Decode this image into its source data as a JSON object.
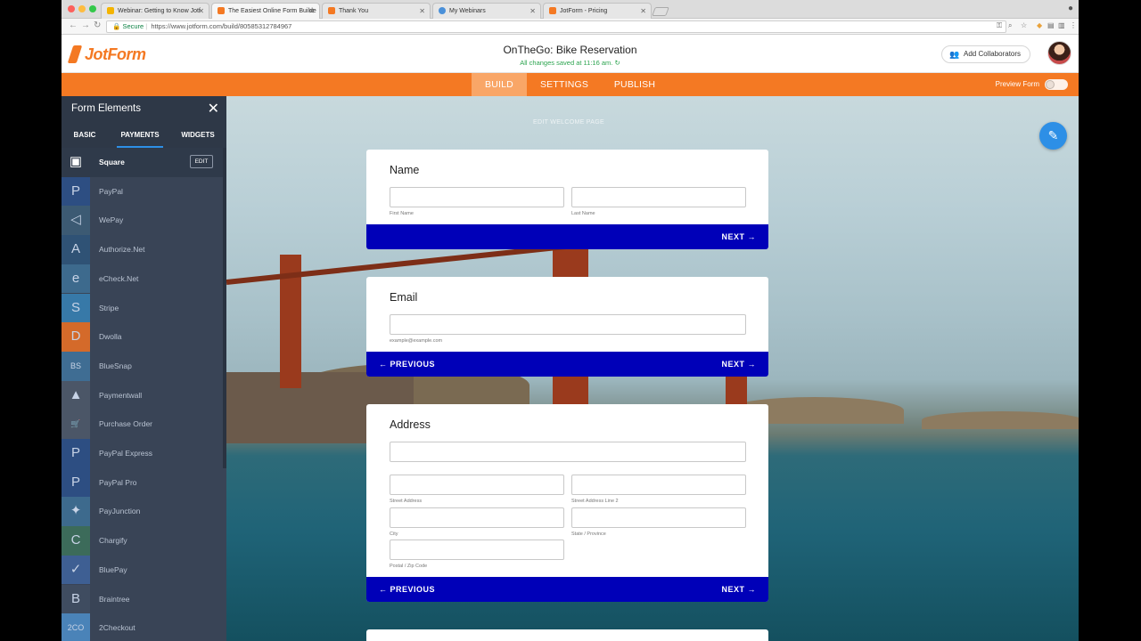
{
  "browser": {
    "tabs": [
      {
        "title": "Webinar: Getting to Know Jotf",
        "active": false
      },
      {
        "title": "The Easiest Online Form Builde",
        "active": true
      },
      {
        "title": "Thank You",
        "active": false
      },
      {
        "title": "My Webinars",
        "active": false
      },
      {
        "title": "JotForm - Pricing",
        "active": false
      }
    ],
    "secure_label": "Secure",
    "url": "https://www.jotform.com/build/80585312784967"
  },
  "header": {
    "logo_text": "JotForm",
    "form_title": "OnTheGo: Bike Reservation",
    "saved_status": "All changes saved at 11:16 am.",
    "collab_label": "Add Collaborators"
  },
  "topnav": {
    "tabs": [
      "BUILD",
      "SETTINGS",
      "PUBLISH"
    ],
    "preview_label": "Preview Form"
  },
  "panel": {
    "title": "Form Elements",
    "tabs": [
      "BASIC",
      "PAYMENTS",
      "WIDGETS"
    ],
    "edit_label": "EDIT",
    "items": [
      {
        "label": "Square",
        "icon": "square-icon",
        "glyph": "▣"
      },
      {
        "label": "PayPal",
        "icon": "paypal-icon",
        "glyph": "P"
      },
      {
        "label": "WePay",
        "icon": "wepay-icon",
        "glyph": "◁"
      },
      {
        "label": "Authorize.Net",
        "icon": "authorize-net-icon",
        "glyph": "A"
      },
      {
        "label": "eCheck.Net",
        "icon": "echeck-icon",
        "glyph": "e"
      },
      {
        "label": "Stripe",
        "icon": "stripe-icon",
        "glyph": "S"
      },
      {
        "label": "Dwolla",
        "icon": "dwolla-icon",
        "glyph": "D"
      },
      {
        "label": "BlueSnap",
        "icon": "bluesnap-icon",
        "glyph": "BS"
      },
      {
        "label": "Paymentwall",
        "icon": "paymentwall-icon",
        "glyph": "▲"
      },
      {
        "label": "Purchase Order",
        "icon": "cart-icon",
        "glyph": "🛒"
      },
      {
        "label": "PayPal Express",
        "icon": "paypal-express-icon",
        "glyph": "P"
      },
      {
        "label": "PayPal Pro",
        "icon": "paypal-pro-icon",
        "glyph": "P"
      },
      {
        "label": "PayJunction",
        "icon": "payjunction-icon",
        "glyph": "✦"
      },
      {
        "label": "Chargify",
        "icon": "chargify-icon",
        "glyph": "C"
      },
      {
        "label": "BluePay",
        "icon": "bluepay-icon",
        "glyph": "✓"
      },
      {
        "label": "Braintree",
        "icon": "braintree-icon",
        "glyph": "B"
      },
      {
        "label": "2Checkout",
        "icon": "2checkout-icon",
        "glyph": "2CO"
      }
    ]
  },
  "canvas": {
    "edit_welcome": "EDIT WELCOME PAGE",
    "cards": [
      {
        "title": "Name",
        "sublabels": [
          "First Name",
          "Last Name"
        ],
        "prev": "",
        "next": "NEXT"
      },
      {
        "title": "Email",
        "sublabels": [
          "example@example.com"
        ],
        "prev": "PREVIOUS",
        "next": "NEXT"
      },
      {
        "title": "Address",
        "sublabels": [
          "Street Address",
          "Street Address Line 2",
          "City",
          "State / Province",
          "Postal / Zip Code"
        ],
        "prev": "PREVIOUS",
        "next": "NEXT"
      }
    ]
  },
  "colors": {
    "brand_orange": "#f47923",
    "nav_blue": "#0000b8",
    "panel_bg": "#394456",
    "saved_green": "#2ca44f"
  }
}
